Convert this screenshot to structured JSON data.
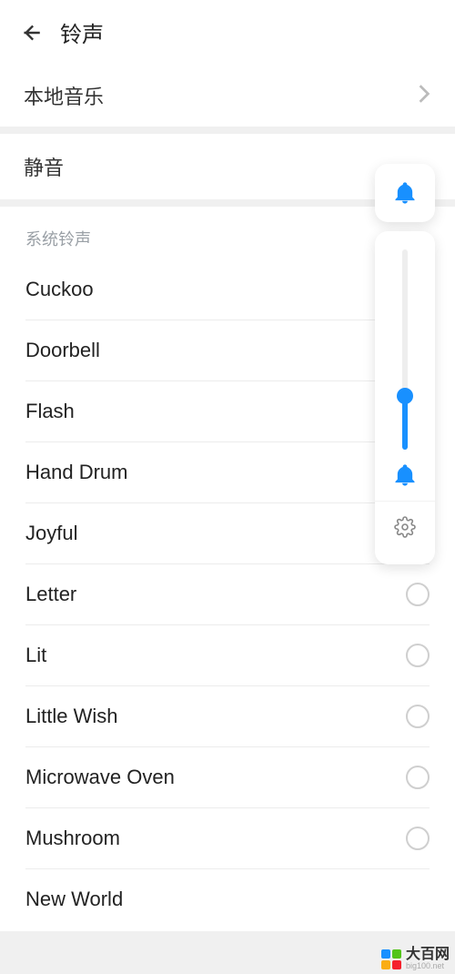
{
  "header": {
    "title": "铃声"
  },
  "local_music": {
    "label": "本地音乐"
  },
  "silent": {
    "label": "静音"
  },
  "system_ringtone": {
    "header": "系统铃声",
    "items": [
      {
        "name": "Cuckoo"
      },
      {
        "name": "Doorbell"
      },
      {
        "name": "Flash"
      },
      {
        "name": "Hand Drum"
      },
      {
        "name": "Joyful"
      },
      {
        "name": "Letter"
      },
      {
        "name": "Lit"
      },
      {
        "name": "Little Wish"
      },
      {
        "name": "Microwave Oven"
      },
      {
        "name": "Mushroom"
      },
      {
        "name": "New World"
      }
    ]
  },
  "volume_panel": {
    "level_percent": 27
  },
  "watermark": {
    "name": "大百网",
    "domain": "big100.net"
  }
}
